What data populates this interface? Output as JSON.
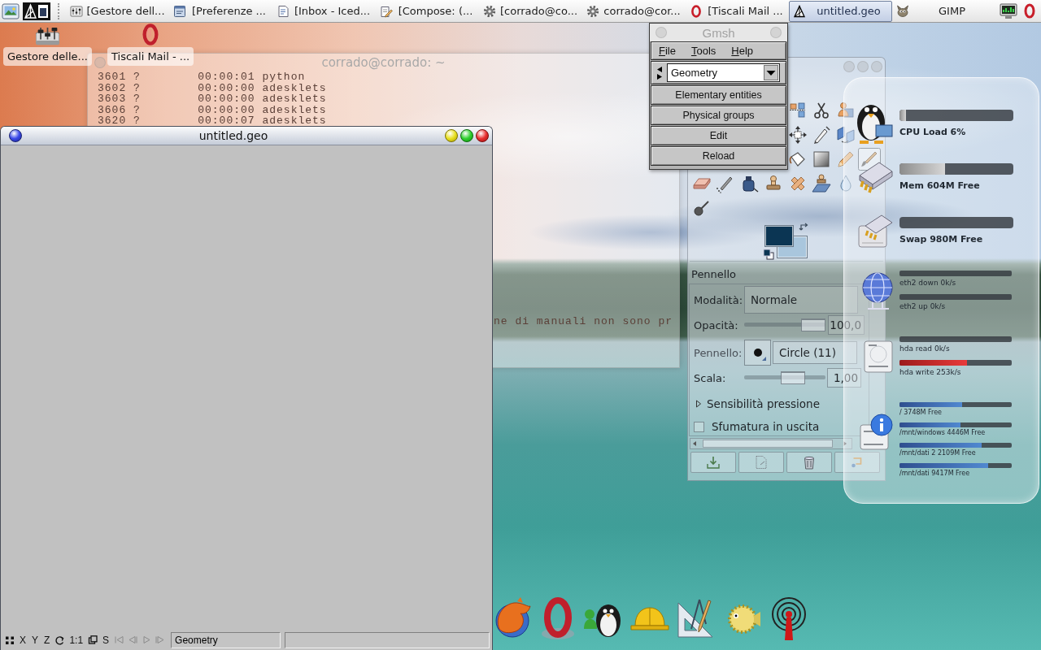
{
  "taskbar": {
    "tasks": [
      {
        "label": "[Gestore dell...",
        "kind": "manager",
        "selected": false
      },
      {
        "label": "[Preferenze ...",
        "kind": "preferences",
        "selected": false
      },
      {
        "label": "[Inbox - Iced...",
        "kind": "mail",
        "selected": false
      },
      {
        "label": "[Compose: (...",
        "kind": "compose",
        "selected": false
      },
      {
        "label": "[corrado@co...",
        "kind": "terminal",
        "selected": false
      },
      {
        "label": "corrado@cor...",
        "kind": "terminal",
        "selected": false
      },
      {
        "label": "[Tiscali Mail ...",
        "kind": "browser",
        "selected": false
      },
      {
        "label": "untitled.geo",
        "kind": "gmsh",
        "selected": true
      },
      {
        "label": "GIMP",
        "kind": "gimp",
        "selected": false
      }
    ]
  },
  "desktop_icons": [
    {
      "label": "Gestore delle...",
      "kind": "mixer"
    },
    {
      "label": "Tiscali Mail - ...",
      "kind": "browser"
    }
  ],
  "terminal": {
    "title": "corrado@corrado: ~",
    "lines": [
      "3601 ?        00:00:01 python",
      "3602 ?        00:00:00 adesklets",
      "3603 ?        00:00:00 adesklets",
      "3606 ?        00:00:00 adesklets",
      "3620 ?        00:00:07 adesklets"
    ],
    "tail": "ne di manuali non sono pr"
  },
  "graphics_window": {
    "title": "untitled.geo",
    "view_buttons": [
      {
        "kind": "grid",
        "disabled": false
      },
      {
        "kind": "text",
        "label": "X",
        "disabled": false
      },
      {
        "kind": "text",
        "label": "Y",
        "disabled": false
      },
      {
        "kind": "text",
        "label": "Z",
        "disabled": false
      },
      {
        "kind": "rotate",
        "disabled": false
      },
      {
        "kind": "text",
        "label": "1:1",
        "disabled": false
      },
      {
        "kind": "window",
        "disabled": false
      },
      {
        "kind": "text",
        "label": "S",
        "disabled": false
      },
      {
        "kind": "first",
        "disabled": true
      },
      {
        "kind": "previous",
        "disabled": true
      },
      {
        "kind": "play",
        "disabled": true
      },
      {
        "kind": "last",
        "disabled": true
      }
    ],
    "module": "Geometry"
  },
  "gmsh": {
    "title": "Gmsh",
    "menu": [
      "File",
      "Tools",
      "Help"
    ],
    "module": "Geometry",
    "buttons": [
      "Elementary entities",
      "Physical groups",
      "Edit",
      "Reload"
    ]
  },
  "gimp": {
    "tools": [
      {
        "kind": "align",
        "selected": false
      },
      {
        "kind": "scissors",
        "selected": false
      },
      {
        "kind": "figure",
        "selected": false
      },
      {
        "kind": "move",
        "selected": false
      },
      {
        "kind": "pen",
        "selected": false
      },
      {
        "kind": "flip",
        "selected": false
      },
      {
        "kind": "bucket",
        "selected": false
      },
      {
        "kind": "gradient",
        "selected": false
      },
      {
        "kind": "pencil",
        "selected": false
      },
      {
        "kind": "brush",
        "selected": true
      },
      {
        "kind": "eraser",
        "selected": false
      },
      {
        "kind": "airbrush",
        "selected": false
      },
      {
        "kind": "ink",
        "selected": false
      },
      {
        "kind": "stamp",
        "selected": false
      },
      {
        "kind": "heal",
        "selected": false
      },
      {
        "kind": "perspective",
        "selected": false
      },
      {
        "kind": "drop",
        "selected": false
      },
      {
        "kind": "smudge",
        "selected": false
      }
    ],
    "options": {
      "title": "Pennello",
      "mode": {
        "label": "Modalità:",
        "value": "Normale"
      },
      "opacity": {
        "label": "Opacità:",
        "level": 1,
        "reading": "100,0"
      },
      "brush": {
        "label": "Pennello:",
        "value": "Circle (11)"
      },
      "scale": {
        "label": "Scala:",
        "level": 0.64,
        "reading": "1,00"
      },
      "pressure": {
        "label": "Sensibilità pressione",
        "expanded": false
      },
      "fade": {
        "label": "Sfumatura in uscita",
        "checked": false
      }
    }
  },
  "monitor": {
    "groups": [
      {
        "kind": "cpu",
        "meters": [
          {
            "label": "CPU Load 6%",
            "level": 0.06
          }
        ]
      },
      {
        "kind": "memory",
        "meters": [
          {
            "label": "Mem 604M Free",
            "level": 0.4
          }
        ]
      },
      {
        "kind": "swap",
        "meters": [
          {
            "label": "Swap 980M Free",
            "level": 0
          }
        ]
      },
      {
        "kind": "network",
        "meters": [
          {
            "label": "eth2 down 0k/s",
            "level": 0
          },
          {
            "label": "eth2 up 0k/s",
            "level": 0
          }
        ]
      },
      {
        "kind": "disk",
        "meters": [
          {
            "label": "hda read 0k/s",
            "level": 0
          },
          {
            "label": "hda write 253k/s",
            "level": 0.6
          }
        ]
      },
      {
        "kind": "storage",
        "meters": [
          {
            "label": "/ 3748M Free",
            "level": 0.56
          },
          {
            "label": "/mnt/windows 4446M Free",
            "level": 0.54
          },
          {
            "label": "/mnt/dati 2 2109M Free",
            "level": 0.73
          },
          {
            "label": "/mnt/dati 9417M Free",
            "level": 0.79
          }
        ]
      }
    ]
  }
}
